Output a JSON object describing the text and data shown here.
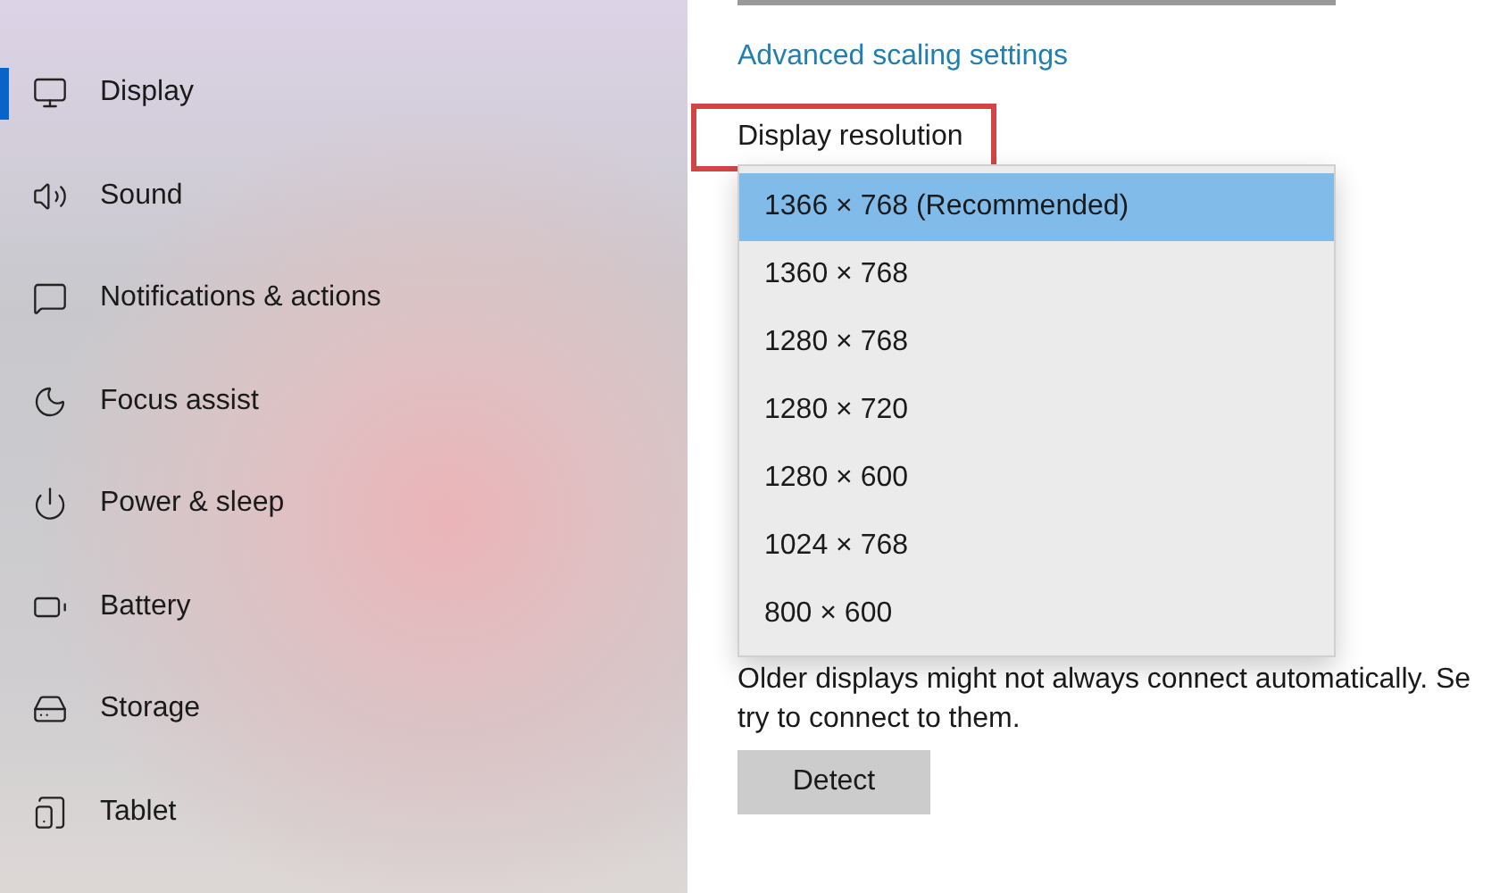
{
  "sidebar": {
    "items": [
      {
        "label": "Display",
        "selected": true
      },
      {
        "label": "Sound",
        "selected": false
      },
      {
        "label": "Notifications & actions",
        "selected": false
      },
      {
        "label": "Focus assist",
        "selected": false
      },
      {
        "label": "Power & sleep",
        "selected": false
      },
      {
        "label": "Battery",
        "selected": false
      },
      {
        "label": "Storage",
        "selected": false
      },
      {
        "label": "Tablet",
        "selected": false
      }
    ]
  },
  "content": {
    "scaling_link": "Advanced scaling settings",
    "resolution_heading": {
      "label": "Display resolution",
      "highlighted": true
    },
    "resolution_options": [
      {
        "label": "1366 × 768 (Recommended)",
        "selected": true
      },
      {
        "label": "1360 × 768",
        "selected": false
      },
      {
        "label": "1280 × 768",
        "selected": false
      },
      {
        "label": "1280 × 720",
        "selected": false
      },
      {
        "label": "1280 × 600",
        "selected": false
      },
      {
        "label": "1024 × 768",
        "selected": false
      },
      {
        "label": "800 × 600",
        "selected": false
      }
    ],
    "description_line_1": "Older displays might not always connect automatically. Se",
    "description_line_2": "try to connect to them.",
    "detect_button": "Detect"
  }
}
